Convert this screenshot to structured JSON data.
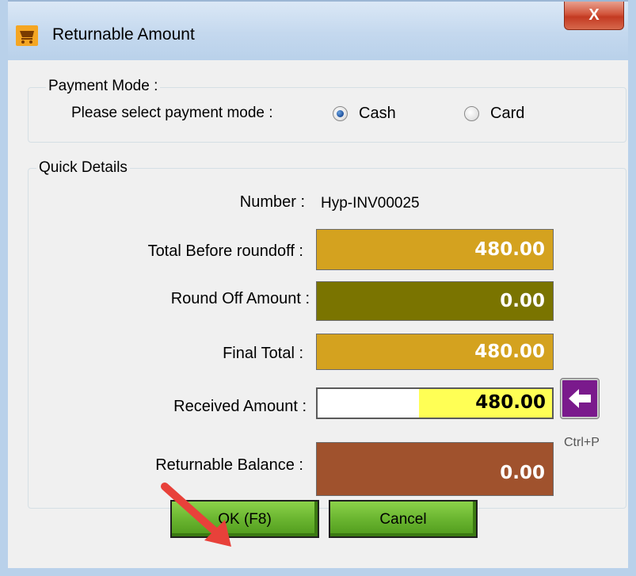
{
  "window": {
    "title": "Returnable Amount",
    "close_label": "X",
    "icon": "shopping-cart-icon"
  },
  "payment_mode": {
    "legend": "Payment Mode :",
    "prompt": "Please select payment mode :",
    "options": [
      {
        "label": "Cash",
        "selected": true
      },
      {
        "label": "Card",
        "selected": false
      }
    ]
  },
  "quick_details": {
    "legend": "Quick Details",
    "number_label": "Number :",
    "number_value": "Hyp-INV00025",
    "total_before_roundoff_label": "Total  Before roundoff :",
    "total_before_roundoff_value": "480.00",
    "round_off_label": "Round Off Amount  :",
    "round_off_value": "0.00",
    "final_total_label": "Final Total :",
    "final_total_value": "480.00",
    "received_amount_label": "Received  Amount  :",
    "received_amount_value": "480.00",
    "returnable_balance_label": "Returnable Balance :",
    "returnable_balance_value": "0.00",
    "shortcut_hint": "Ctrl+P"
  },
  "buttons": {
    "ok_label": "OK (F8)",
    "cancel_label": "Cancel"
  },
  "colors": {
    "gold": "#d4a21f",
    "olive": "#7a7400",
    "brown": "#a0522d",
    "yellow": "#ffff55",
    "purple": "#7a1a8c",
    "green": "#6ab530"
  }
}
